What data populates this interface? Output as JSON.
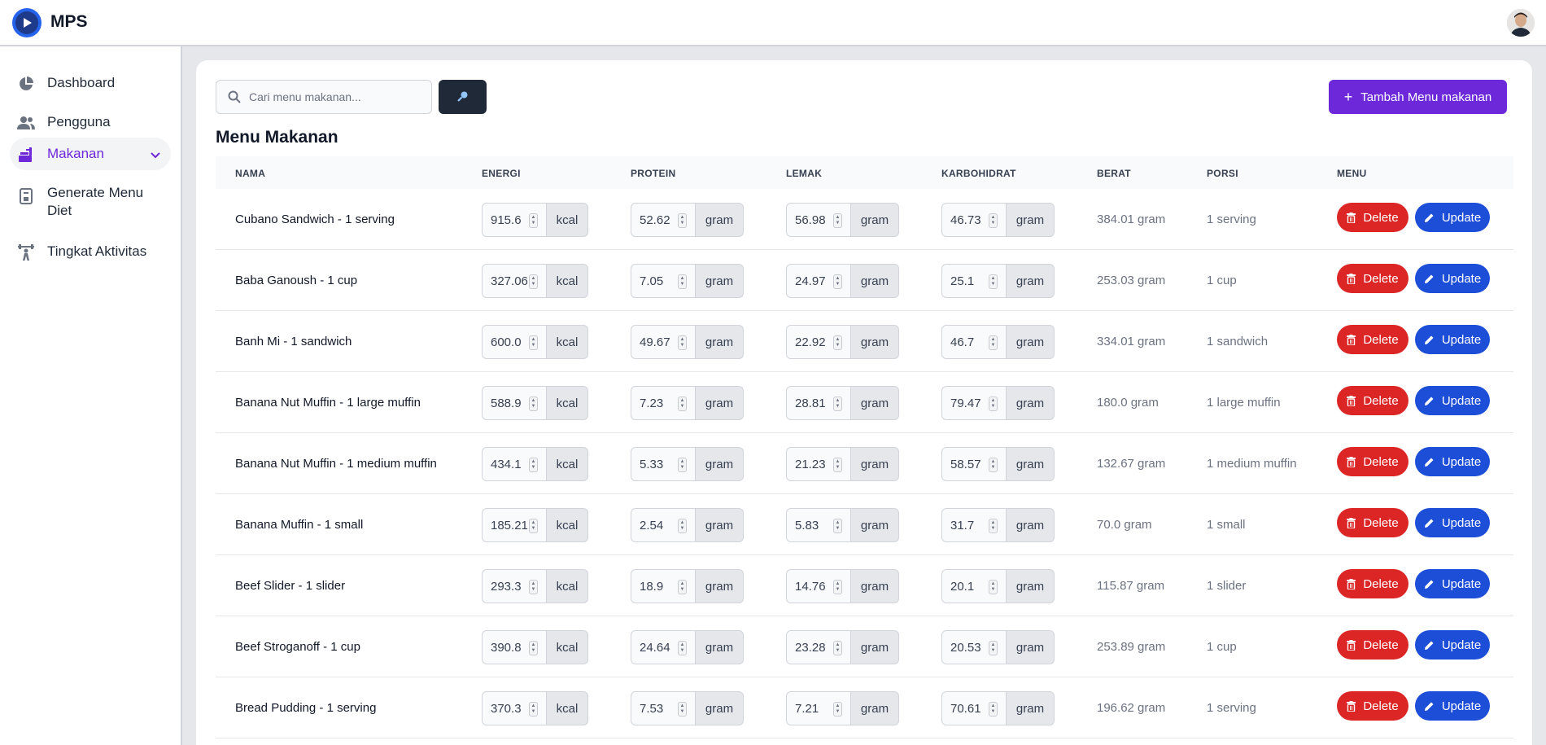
{
  "app": {
    "name": "MPS"
  },
  "sidebar": {
    "items": [
      {
        "label": "Dashboard",
        "icon": "pie-chart-icon"
      },
      {
        "label": "Pengguna",
        "icon": "users-icon"
      },
      {
        "label": "Makanan",
        "icon": "food-icon",
        "active": true
      },
      {
        "label": "Generate Menu Diet",
        "icon": "menu-icon"
      },
      {
        "label": "Tingkat Aktivitas",
        "icon": "dumbbell-icon"
      }
    ]
  },
  "toolbar": {
    "search_placeholder": "Cari menu makanan...",
    "add_label": "Tambah Menu makanan"
  },
  "page": {
    "title": "Menu Makanan"
  },
  "table": {
    "columns": [
      "NAMA",
      "ENERGI",
      "PROTEIN",
      "LEMAK",
      "KARBOHIDRAT",
      "BERAT",
      "PORSI",
      "MENU"
    ],
    "energy_unit": "kcal",
    "macro_unit": "gram",
    "delete_label": "Delete",
    "update_label": "Update",
    "rows": [
      {
        "name": "Cubano Sandwich - 1 serving",
        "energi": "915.6",
        "protein": "52.62",
        "lemak": "56.98",
        "karbohidrat": "46.73",
        "berat": "384.01 gram",
        "porsi": "1 serving"
      },
      {
        "name": "Baba Ganoush - 1 cup",
        "energi": "327.06",
        "protein": "7.05",
        "lemak": "24.97",
        "karbohidrat": "25.1",
        "berat": "253.03 gram",
        "porsi": "1 cup"
      },
      {
        "name": "Banh Mi - 1 sandwich",
        "energi": "600.0",
        "protein": "49.67",
        "lemak": "22.92",
        "karbohidrat": "46.7",
        "berat": "334.01 gram",
        "porsi": "1 sandwich"
      },
      {
        "name": "Banana Nut Muffin - 1 large muffin",
        "energi": "588.9",
        "protein": "7.23",
        "lemak": "28.81",
        "karbohidrat": "79.47",
        "berat": "180.0 gram",
        "porsi": "1 large muffin"
      },
      {
        "name": "Banana Nut Muffin - 1 medium muffin",
        "energi": "434.1",
        "protein": "5.33",
        "lemak": "21.23",
        "karbohidrat": "58.57",
        "berat": "132.67 gram",
        "porsi": "1 medium muffin"
      },
      {
        "name": "Banana Muffin - 1 small",
        "energi": "185.21",
        "protein": "2.54",
        "lemak": "5.83",
        "karbohidrat": "31.7",
        "berat": "70.0 gram",
        "porsi": "1 small"
      },
      {
        "name": "Beef Slider - 1 slider",
        "energi": "293.3",
        "protein": "18.9",
        "lemak": "14.76",
        "karbohidrat": "20.1",
        "berat": "115.87 gram",
        "porsi": "1 slider"
      },
      {
        "name": "Beef Stroganoff - 1 cup",
        "energi": "390.8",
        "protein": "24.64",
        "lemak": "23.28",
        "karbohidrat": "20.53",
        "berat": "253.89 gram",
        "porsi": "1 cup"
      },
      {
        "name": "Bread Pudding - 1 serving",
        "energi": "370.3",
        "protein": "7.53",
        "lemak": "7.21",
        "karbohidrat": "70.61",
        "berat": "196.62 gram",
        "porsi": "1 serving"
      }
    ]
  },
  "colors": {
    "primary": "#6d28d9",
    "delete": "#dc2626",
    "update": "#1d4ed8",
    "logo": "#2563eb"
  }
}
